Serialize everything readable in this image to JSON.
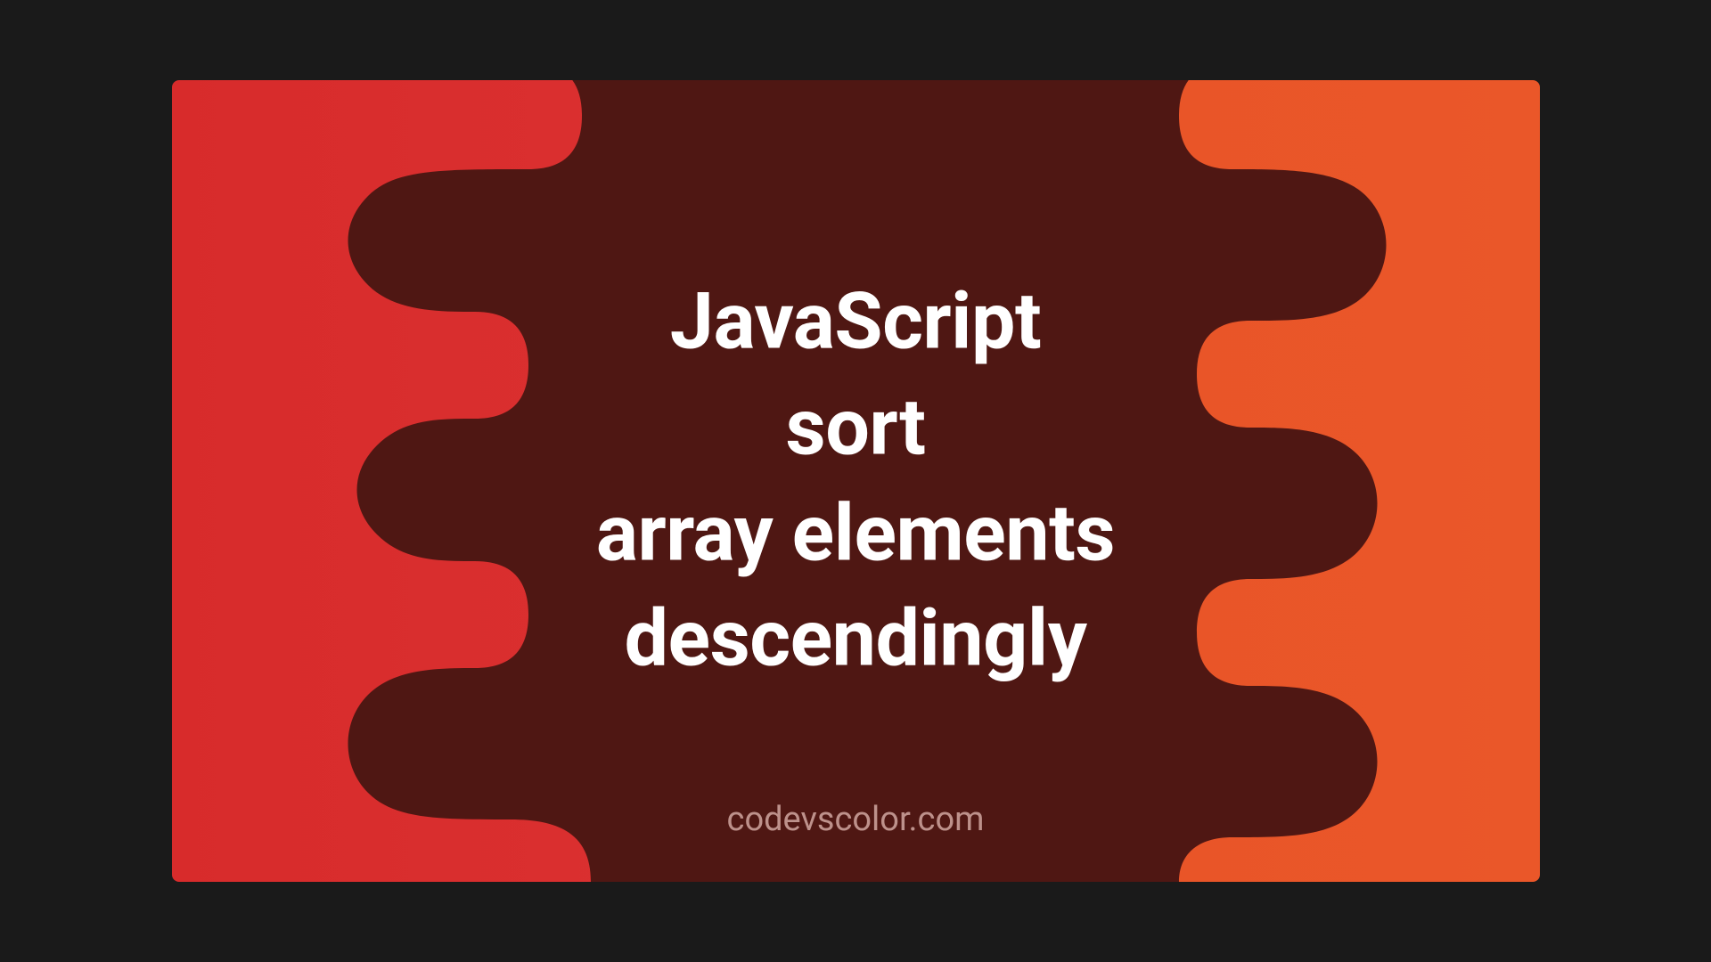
{
  "title": {
    "line1": "JavaScript",
    "line2": "sort",
    "line3": "array elements",
    "line4": "descendingly"
  },
  "footer": "codevscolor.com",
  "colors": {
    "left_gradient_start": "#d82b2b",
    "left_gradient_end": "#de3a3a",
    "right_bg": "#ea5729",
    "blob": "#4f1713",
    "text": "#ffffff",
    "footer_text": "#bd918b"
  }
}
